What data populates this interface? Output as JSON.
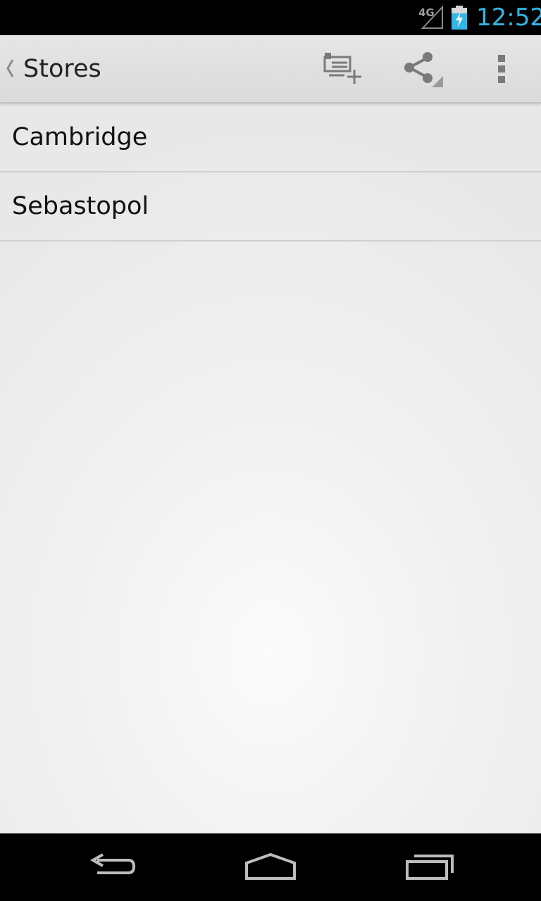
{
  "status_bar": {
    "network_label": "4G",
    "time": "12:52",
    "clock_color": "#33b5e5",
    "icons": [
      "signal-icon",
      "battery-charging-icon"
    ]
  },
  "action_bar": {
    "title": "Stores",
    "actions": [
      {
        "name": "new-list-item-icon"
      },
      {
        "name": "share-icon"
      },
      {
        "name": "overflow-menu-icon"
      }
    ]
  },
  "list": {
    "items": [
      {
        "label": "Cambridge"
      },
      {
        "label": "Sebastopol"
      }
    ]
  },
  "nav_bar": {
    "buttons": [
      "back-icon",
      "home-icon",
      "recent-apps-icon"
    ]
  }
}
